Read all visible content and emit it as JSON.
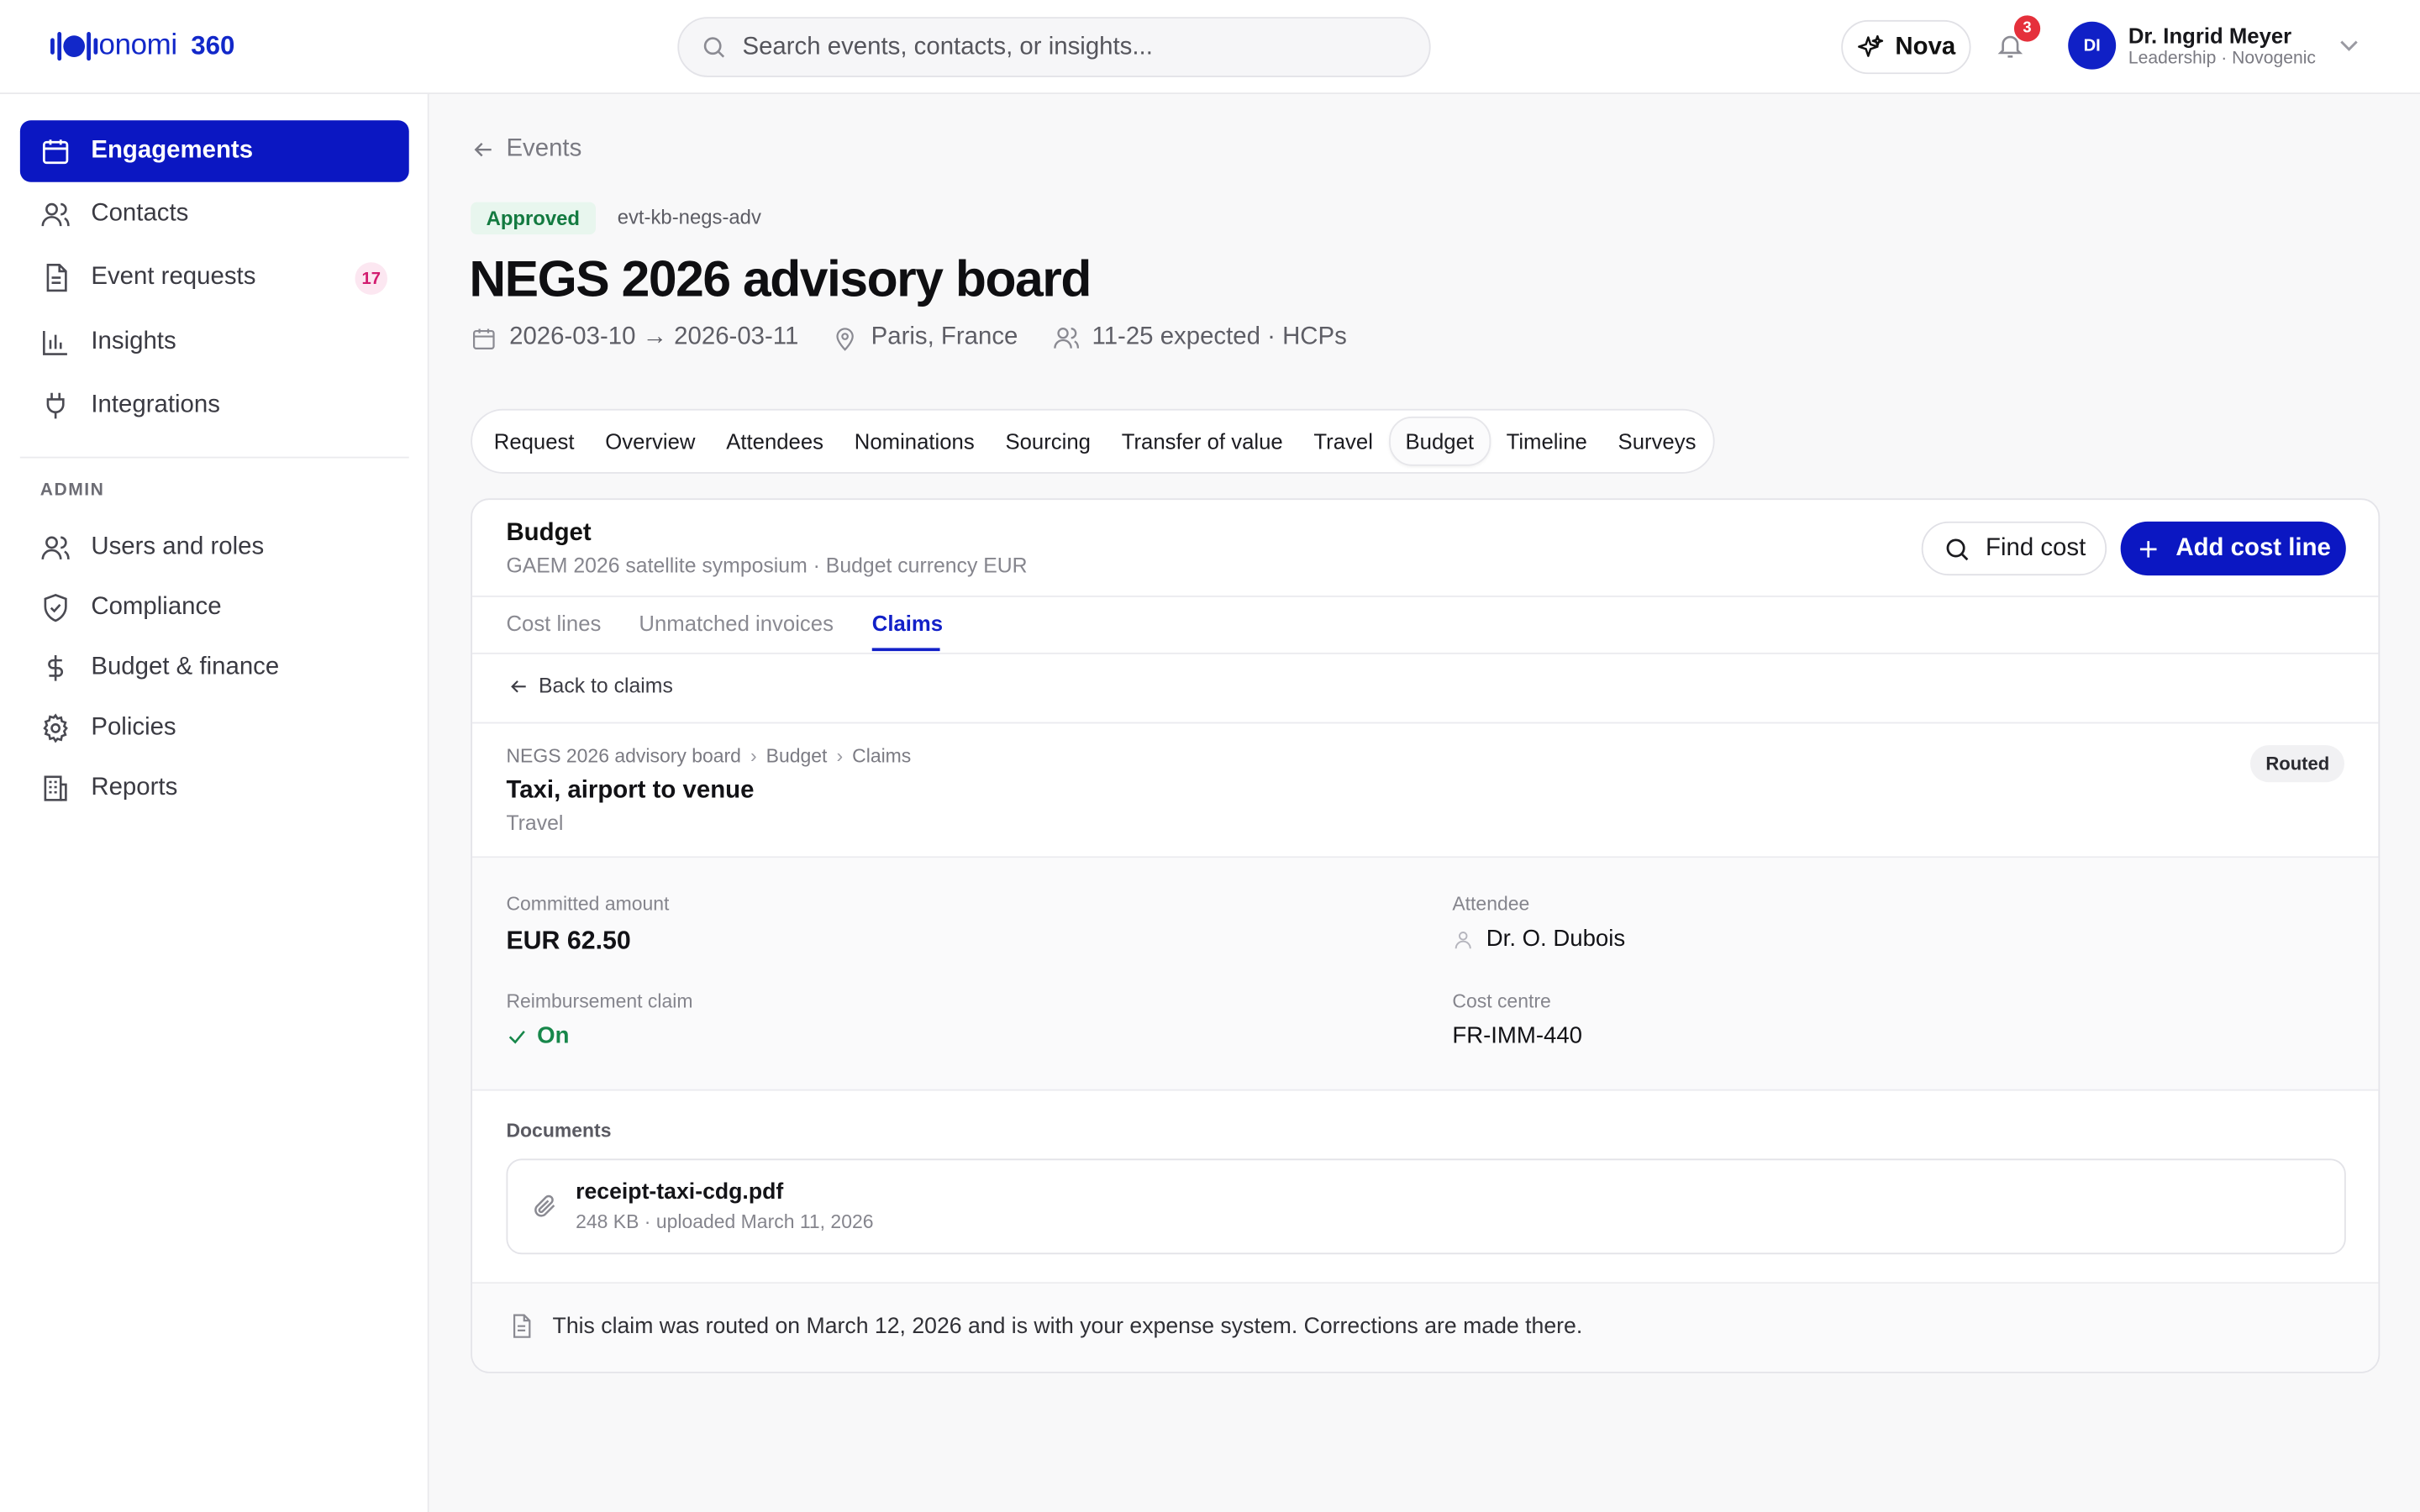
{
  "app": {
    "logo_word": "onomi",
    "logo_suffix": "360",
    "brand_color": "#1228c9"
  },
  "search": {
    "placeholder": "Search events, contacts, or insights..."
  },
  "header": {
    "nova_label": "Nova",
    "notification_count": "3",
    "user": {
      "initials": "DI",
      "name": "Dr. Ingrid Meyer",
      "role": "Leadership · Novogenic"
    }
  },
  "sidebar": {
    "items": [
      {
        "label": "Engagements",
        "icon": "calendar-icon",
        "active": true
      },
      {
        "label": "Contacts",
        "icon": "users-icon"
      },
      {
        "label": "Event requests",
        "icon": "document-icon",
        "badge": "17"
      },
      {
        "label": "Insights",
        "icon": "bar-chart-icon"
      },
      {
        "label": "Integrations",
        "icon": "plug-icon"
      }
    ],
    "admin_label": "ADMIN",
    "admin_items": [
      {
        "label": "Users and roles",
        "icon": "users-icon"
      },
      {
        "label": "Compliance",
        "icon": "shield-check-icon"
      },
      {
        "label": "Budget & finance",
        "icon": "dollar-icon"
      },
      {
        "label": "Policies",
        "icon": "gear-icon"
      },
      {
        "label": "Reports",
        "icon": "building-icon"
      }
    ]
  },
  "event": {
    "back_label": "Events",
    "status": "Approved",
    "code": "evt-kb-negs-adv",
    "title": "NEGS 2026 advisory board",
    "dates": "2026-03-10 → 2026-03-11",
    "location": "Paris, France",
    "attendance": "11-25 expected · HCPs"
  },
  "tabs": [
    "Request",
    "Overview",
    "Attendees",
    "Nominations",
    "Sourcing",
    "Transfer of value",
    "Travel",
    "Budget",
    "Timeline",
    "Surveys"
  ],
  "active_tab": "Budget",
  "budget": {
    "title": "Budget",
    "subtitle": "GAEM 2026 satellite symposium · Budget currency EUR",
    "find_label": "Find cost",
    "add_label": "Add cost line",
    "subtabs": [
      "Cost lines",
      "Unmatched invoices",
      "Claims"
    ],
    "active_subtab": "Claims",
    "back_label": "Back to claims"
  },
  "claim": {
    "breadcrumb": [
      "NEGS 2026 advisory board",
      "Budget",
      "Claims"
    ],
    "status": "Routed",
    "title": "Taxi, airport to venue",
    "category": "Travel",
    "committed_label": "Committed amount",
    "committed_value": "EUR 62.50",
    "attendee_label": "Attendee",
    "attendee_value": "Dr. O. Dubois",
    "reimb_label": "Reimbursement claim",
    "reimb_value": "On",
    "cost_centre_label": "Cost centre",
    "cost_centre_value": "FR-IMM-440",
    "documents_label": "Documents",
    "document": {
      "name": "receipt-taxi-cdg.pdf",
      "meta": "248 KB · uploaded March 11, 2026"
    },
    "note": "This claim was routed on March 12, 2026 and is with your expense system. Corrections are made there."
  }
}
